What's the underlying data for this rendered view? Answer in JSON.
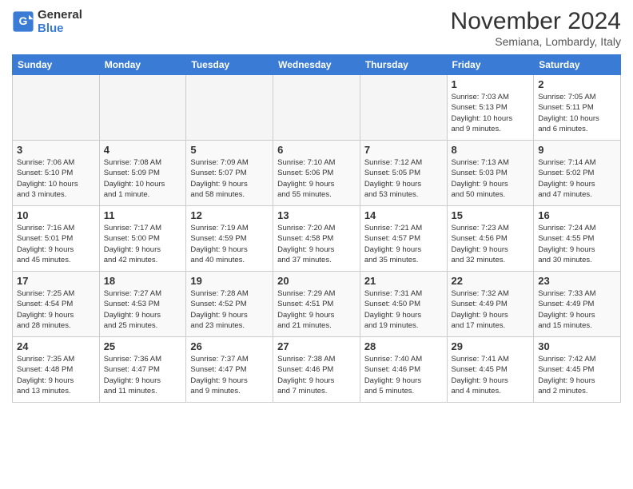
{
  "header": {
    "logo_line1": "General",
    "logo_line2": "Blue",
    "month_title": "November 2024",
    "subtitle": "Semiana, Lombardy, Italy"
  },
  "weekdays": [
    "Sunday",
    "Monday",
    "Tuesday",
    "Wednesday",
    "Thursday",
    "Friday",
    "Saturday"
  ],
  "weeks": [
    [
      {
        "day": "",
        "empty": true
      },
      {
        "day": "",
        "empty": true
      },
      {
        "day": "",
        "empty": true
      },
      {
        "day": "",
        "empty": true
      },
      {
        "day": "",
        "empty": true
      },
      {
        "day": "1",
        "info": "Sunrise: 7:03 AM\nSunset: 5:13 PM\nDaylight: 10 hours\nand 9 minutes."
      },
      {
        "day": "2",
        "info": "Sunrise: 7:05 AM\nSunset: 5:11 PM\nDaylight: 10 hours\nand 6 minutes."
      }
    ],
    [
      {
        "day": "3",
        "info": "Sunrise: 7:06 AM\nSunset: 5:10 PM\nDaylight: 10 hours\nand 3 minutes."
      },
      {
        "day": "4",
        "info": "Sunrise: 7:08 AM\nSunset: 5:09 PM\nDaylight: 10 hours\nand 1 minute."
      },
      {
        "day": "5",
        "info": "Sunrise: 7:09 AM\nSunset: 5:07 PM\nDaylight: 9 hours\nand 58 minutes."
      },
      {
        "day": "6",
        "info": "Sunrise: 7:10 AM\nSunset: 5:06 PM\nDaylight: 9 hours\nand 55 minutes."
      },
      {
        "day": "7",
        "info": "Sunrise: 7:12 AM\nSunset: 5:05 PM\nDaylight: 9 hours\nand 53 minutes."
      },
      {
        "day": "8",
        "info": "Sunrise: 7:13 AM\nSunset: 5:03 PM\nDaylight: 9 hours\nand 50 minutes."
      },
      {
        "day": "9",
        "info": "Sunrise: 7:14 AM\nSunset: 5:02 PM\nDaylight: 9 hours\nand 47 minutes."
      }
    ],
    [
      {
        "day": "10",
        "info": "Sunrise: 7:16 AM\nSunset: 5:01 PM\nDaylight: 9 hours\nand 45 minutes."
      },
      {
        "day": "11",
        "info": "Sunrise: 7:17 AM\nSunset: 5:00 PM\nDaylight: 9 hours\nand 42 minutes."
      },
      {
        "day": "12",
        "info": "Sunrise: 7:19 AM\nSunset: 4:59 PM\nDaylight: 9 hours\nand 40 minutes."
      },
      {
        "day": "13",
        "info": "Sunrise: 7:20 AM\nSunset: 4:58 PM\nDaylight: 9 hours\nand 37 minutes."
      },
      {
        "day": "14",
        "info": "Sunrise: 7:21 AM\nSunset: 4:57 PM\nDaylight: 9 hours\nand 35 minutes."
      },
      {
        "day": "15",
        "info": "Sunrise: 7:23 AM\nSunset: 4:56 PM\nDaylight: 9 hours\nand 32 minutes."
      },
      {
        "day": "16",
        "info": "Sunrise: 7:24 AM\nSunset: 4:55 PM\nDaylight: 9 hours\nand 30 minutes."
      }
    ],
    [
      {
        "day": "17",
        "info": "Sunrise: 7:25 AM\nSunset: 4:54 PM\nDaylight: 9 hours\nand 28 minutes."
      },
      {
        "day": "18",
        "info": "Sunrise: 7:27 AM\nSunset: 4:53 PM\nDaylight: 9 hours\nand 25 minutes."
      },
      {
        "day": "19",
        "info": "Sunrise: 7:28 AM\nSunset: 4:52 PM\nDaylight: 9 hours\nand 23 minutes."
      },
      {
        "day": "20",
        "info": "Sunrise: 7:29 AM\nSunset: 4:51 PM\nDaylight: 9 hours\nand 21 minutes."
      },
      {
        "day": "21",
        "info": "Sunrise: 7:31 AM\nSunset: 4:50 PM\nDaylight: 9 hours\nand 19 minutes."
      },
      {
        "day": "22",
        "info": "Sunrise: 7:32 AM\nSunset: 4:49 PM\nDaylight: 9 hours\nand 17 minutes."
      },
      {
        "day": "23",
        "info": "Sunrise: 7:33 AM\nSunset: 4:49 PM\nDaylight: 9 hours\nand 15 minutes."
      }
    ],
    [
      {
        "day": "24",
        "info": "Sunrise: 7:35 AM\nSunset: 4:48 PM\nDaylight: 9 hours\nand 13 minutes."
      },
      {
        "day": "25",
        "info": "Sunrise: 7:36 AM\nSunset: 4:47 PM\nDaylight: 9 hours\nand 11 minutes."
      },
      {
        "day": "26",
        "info": "Sunrise: 7:37 AM\nSunset: 4:47 PM\nDaylight: 9 hours\nand 9 minutes."
      },
      {
        "day": "27",
        "info": "Sunrise: 7:38 AM\nSunset: 4:46 PM\nDaylight: 9 hours\nand 7 minutes."
      },
      {
        "day": "28",
        "info": "Sunrise: 7:40 AM\nSunset: 4:46 PM\nDaylight: 9 hours\nand 5 minutes."
      },
      {
        "day": "29",
        "info": "Sunrise: 7:41 AM\nSunset: 4:45 PM\nDaylight: 9 hours\nand 4 minutes."
      },
      {
        "day": "30",
        "info": "Sunrise: 7:42 AM\nSunset: 4:45 PM\nDaylight: 9 hours\nand 2 minutes."
      }
    ]
  ]
}
